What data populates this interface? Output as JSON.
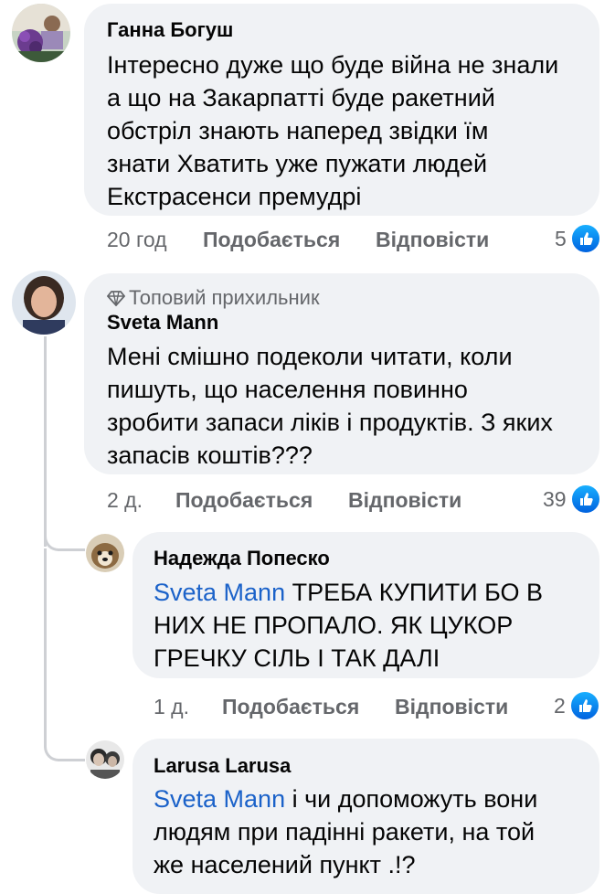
{
  "comments": [
    {
      "author": "Ганна Богуш",
      "lines": [
        "Інтересно дуже що буде війна не знали",
        "а що на Закарпатті буде ракетний",
        "обстріл знають наперед звідки їм",
        "знати Хватить уже пужати людей",
        "Екстрасенси премудрі"
      ],
      "time": "20 год",
      "like_label": "Подобається",
      "reply_label": "Відповісти",
      "reactions": "5"
    },
    {
      "badge": "Топовий прихильник",
      "author": "Sveta Mann",
      "lines": [
        "Мені смішно подеколи читати, коли",
        "пишуть, що населення повинно",
        "зробити запаси ліків і продуктів. З яких",
        "запасів коштів???"
      ],
      "time": "2 д.",
      "like_label": "Подобається",
      "reply_label": "Відповісти",
      "reactions": "39"
    }
  ],
  "replies": [
    {
      "author": "Надежда Попеско",
      "mention": "Sveta Mann",
      "first_line_rest": " ТРЕБА КУПИТИ БО В",
      "lines": [
        "НИХ НЕ ПРОПАЛО. ЯК ЦУКОР",
        "ГРЕЧКУ СІЛЬ І ТАК ДАЛІ"
      ],
      "time": "1 д.",
      "like_label": "Подобається",
      "reply_label": "Відповісти",
      "reactions": "2"
    },
    {
      "author": "Larusa Larusa",
      "mention": "Sveta Mann",
      "first_line_rest": " і чи допоможуть вони",
      "lines": [
        "людям при падінні ракети, на той",
        "же населений пункт .!?"
      ]
    }
  ],
  "colors": {
    "bubble": "#f0f2f5",
    "meta": "#65676b",
    "mention": "#1b62c9",
    "like_blue": "#1877f2"
  },
  "icons": {
    "badge": "diamond-icon",
    "reaction": "like-icon"
  }
}
